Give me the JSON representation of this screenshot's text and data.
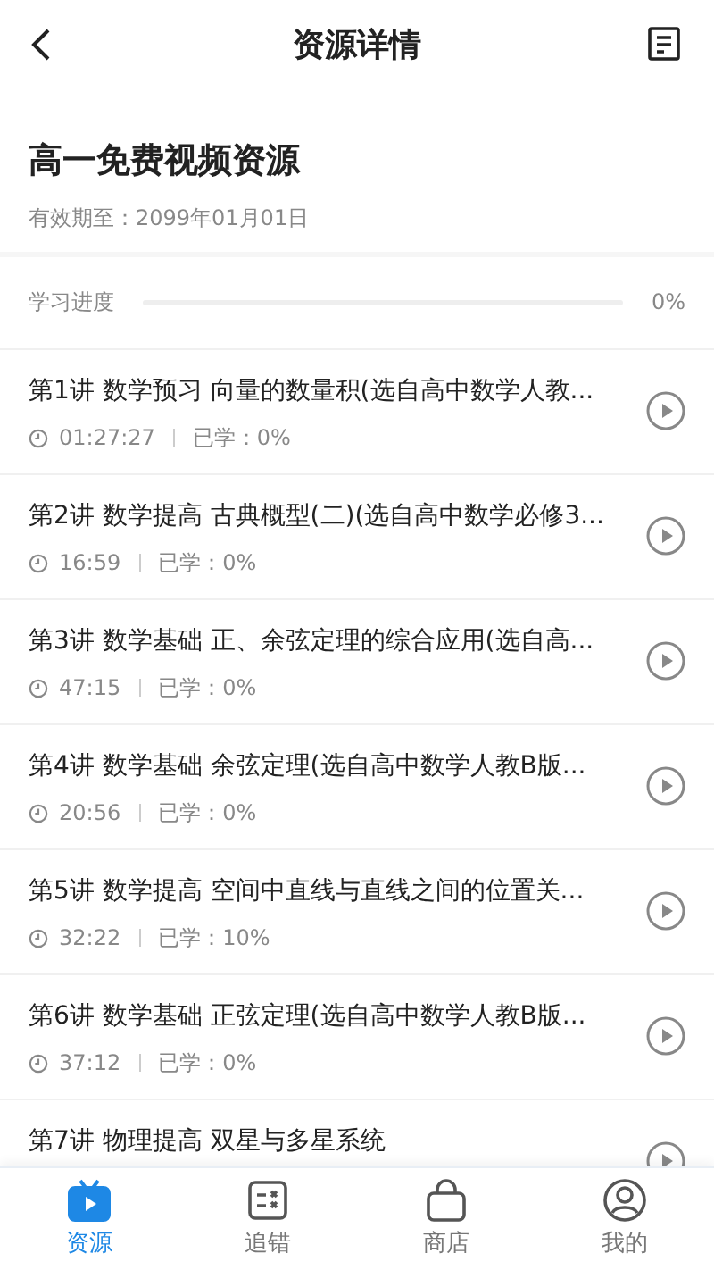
{
  "header": {
    "title": "资源详情"
  },
  "resource": {
    "title": "高一免费视频资源",
    "expiry": "有效期至：2099年01月01日"
  },
  "progress": {
    "label": "学习进度",
    "level": 0,
    "reading": "0%"
  },
  "lessons": [
    {
      "title": "第1讲 数学预习 向量的数量积(选自高中数学人教...",
      "duration": "01:27:27",
      "studied": "已学：0%"
    },
    {
      "title": "第2讲 数学提高 古典概型(二)(选自高中数学必修3...",
      "duration": "16:59",
      "studied": "已学：0%"
    },
    {
      "title": "第3讲 数学基础 正、余弦定理的综合应用(选自高...",
      "duration": "47:15",
      "studied": "已学：0%"
    },
    {
      "title": "第4讲 数学基础 余弦定理(选自高中数学人教B版...",
      "duration": "20:56",
      "studied": "已学：0%"
    },
    {
      "title": "第5讲 数学提高 空间中直线与直线之间的位置关...",
      "duration": "32:22",
      "studied": "已学：10%"
    },
    {
      "title": "第6讲 数学基础 正弦定理(选自高中数学人教B版...",
      "duration": "37:12",
      "studied": "已学：0%"
    },
    {
      "title": "第7讲 物理提高 双星与多星系统"
    }
  ],
  "nav": [
    {
      "kind": "resources",
      "label": "资源",
      "selected": true
    },
    {
      "kind": "mistakes",
      "label": "追错",
      "selected": false
    },
    {
      "kind": "shop",
      "label": "商店",
      "selected": false
    },
    {
      "kind": "profile",
      "label": "我的",
      "selected": false
    }
  ]
}
